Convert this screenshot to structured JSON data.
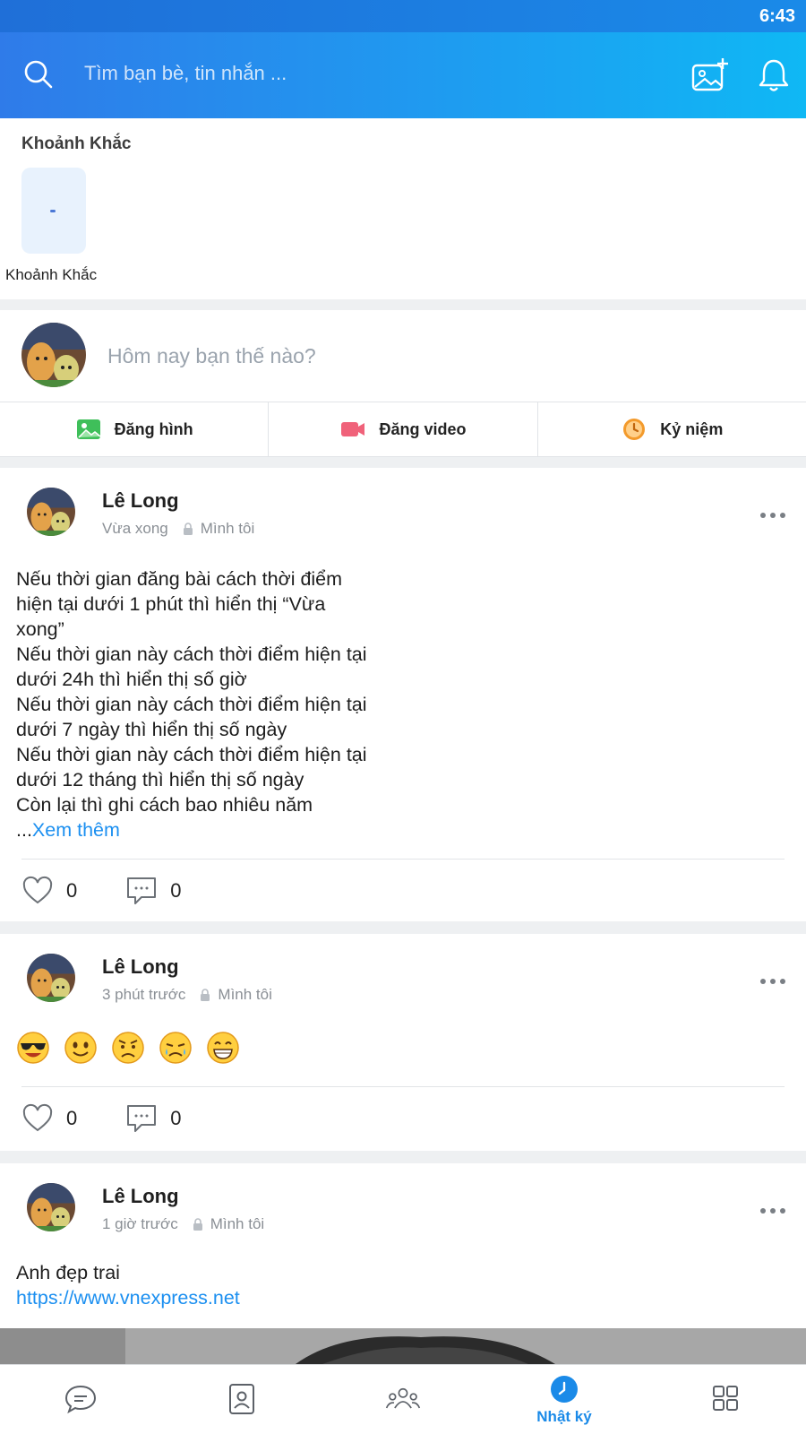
{
  "status_bar": {
    "time": "6:43"
  },
  "header": {
    "search_placeholder": "Tìm bạn bè, tin nhắn ...",
    "icons": [
      "search-icon",
      "photo-add-icon",
      "bell-icon"
    ]
  },
  "moments": {
    "title": "Khoảnh Khắc",
    "items": [
      {
        "label": "Khoảnh Khắc"
      }
    ]
  },
  "composer": {
    "prompt": "Hôm nay bạn thế nào?",
    "actions": [
      {
        "label": "Đăng hình",
        "icon": "image-icon",
        "color": "#3fbf5a"
      },
      {
        "label": "Đăng video",
        "icon": "video-icon",
        "color": "#f0627a"
      },
      {
        "label": "Kỷ niệm",
        "icon": "memory-clock-icon",
        "color": "#f39a2b"
      }
    ]
  },
  "posts": [
    {
      "author": "Lê Long",
      "time": "Vừa xong",
      "privacy": "Mình tôi",
      "lines": [
        "Nếu thời gian đăng bài cách thời điểm",
        "hiện tại dưới 1 phút thì hiển thị “Vừa",
        "xong”",
        "Nếu thời gian này cách thời điểm hiện tại",
        "dưới 24h thì hiển thị số giờ",
        "Nếu thời gian này cách thời điểm hiện tại",
        "dưới 7 ngày thì hiển thị số ngày",
        "Nếu thời gian này cách thời điểm hiện tại",
        "dưới 12 tháng thì hiển thị số ngày",
        "Còn lại thì ghi cách bao nhiêu năm"
      ],
      "see_more_prefix": "...",
      "see_more": "Xem thêm",
      "likes": "0",
      "comments": "0"
    },
    {
      "author": "Lê Long",
      "time": "3 phút trước",
      "privacy": "Mình tôi",
      "emojis": [
        "cool-emoji-icon",
        "smile-emoji-icon",
        "worried-emoji-icon",
        "crying-emoji-icon",
        "grin-emoji-icon"
      ],
      "likes": "0",
      "comments": "0"
    },
    {
      "author": "Lê Long",
      "time": "1 giờ trước",
      "privacy": "Mình tôi",
      "text": "Anh đẹp trai",
      "link": "https://www.vnexpress.net"
    }
  ],
  "bottom_nav": {
    "tabs": [
      {
        "icon": "chat-icon",
        "label": ""
      },
      {
        "icon": "contacts-icon",
        "label": ""
      },
      {
        "icon": "groups-icon",
        "label": ""
      },
      {
        "icon": "timeline-icon",
        "label": "Nhật ký",
        "active": true
      },
      {
        "icon": "grid-icon",
        "label": ""
      }
    ],
    "active_color": "#1a8ae8"
  }
}
